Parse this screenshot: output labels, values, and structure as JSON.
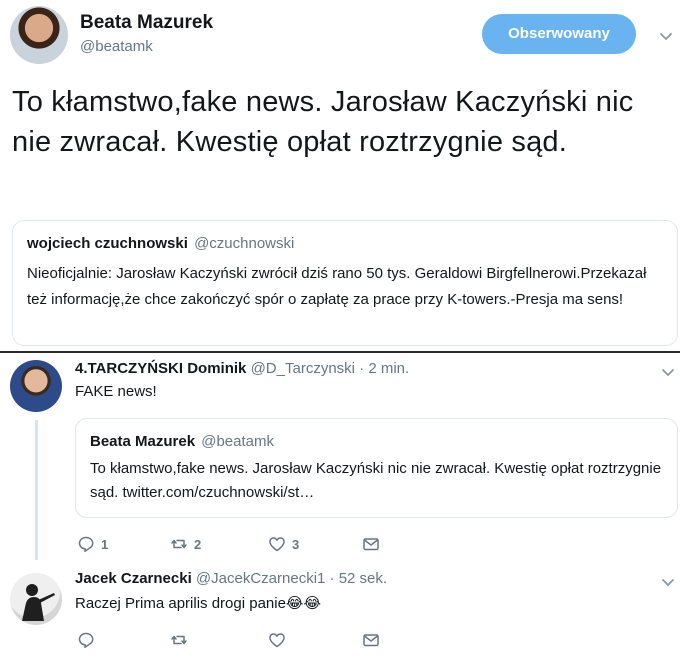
{
  "main_tweet": {
    "author_name": "Beata Mazurek",
    "author_handle": "@beatamk",
    "follow_label": "Obserwowany",
    "text": "To kłamstwo,fake news. Jarosław Kaczyński nic nie zwracał. Kwestię opłat roztrzygnie sąd.",
    "quoted": {
      "author_name": "wojciech czuchnowski",
      "author_handle": "@czuchnowski",
      "text": "Nieoficjalnie: Jarosław Kaczyński zwrócił dziś rano 50 tys. Geraldowi Birgfellnerowi.Przekazał też informację,że chce zakończyć spór o zapłatę za prace przy K-towers.-Presja ma sens!"
    }
  },
  "replies": [
    {
      "author_name": "4.TARCZYŃSKI Dominik",
      "author_handle": "@D_Tarczynski",
      "time": "· 2 min.",
      "text": "FAKE news!",
      "quoted": {
        "author_name": "Beata Mazurek",
        "author_handle": "@beatamk",
        "text": "To kłamstwo,fake news. Jarosław Kaczyński nic nie zwracał. Kwestię opłat roztrzygnie sąd. twitter.com/czuchnowski/st…"
      },
      "actions": {
        "replies": "1",
        "retweets": "2",
        "likes": "3"
      }
    },
    {
      "author_name": "Jacek Czarnecki",
      "author_handle": "@JacekCzarnecki1",
      "time": "· 52 sek.",
      "text": "Raczej Prima aprilis drogi panie😂😂",
      "actions": {
        "replies": "",
        "retweets": "",
        "likes": ""
      }
    }
  ],
  "icons": {
    "reply": "reply-icon",
    "retweet": "retweet-icon",
    "like": "heart-icon",
    "message": "envelope-icon",
    "more": "chevron-down-icon"
  },
  "colors": {
    "accent": "#69b3f0",
    "secondary_text": "#657786",
    "thread_line": "#cfe6fa"
  }
}
